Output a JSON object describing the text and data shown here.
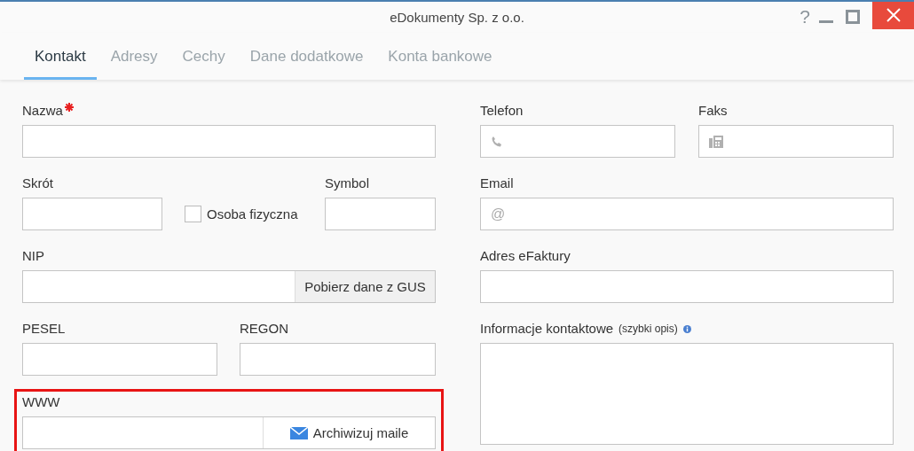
{
  "window": {
    "title": "eDokumenty Sp. z o.o.",
    "help": "?"
  },
  "tabs": [
    {
      "label": "Kontakt",
      "selected": true
    },
    {
      "label": "Adresy",
      "selected": false
    },
    {
      "label": "Cechy",
      "selected": false
    },
    {
      "label": "Dane dodatkowe",
      "selected": false
    },
    {
      "label": "Konta bankowe",
      "selected": false
    }
  ],
  "form": {
    "left": [
      [
        {
          "kind": "input",
          "label": "Nazwa",
          "required": true
        }
      ],
      [
        {
          "kind": "input",
          "label": "Skrót"
        },
        {
          "kind": "checkbox",
          "label": "Osoba fizyczna",
          "checked": false
        },
        {
          "kind": "input",
          "label": "Symbol"
        }
      ],
      [
        {
          "kind": "input_button",
          "label": "NIP",
          "button": {
            "kind": "plain",
            "label": "Pobierz dane z GUS"
          }
        }
      ],
      [
        {
          "kind": "input",
          "label": "PESEL"
        },
        {
          "kind": "input",
          "label": "REGON"
        }
      ],
      [
        {
          "kind": "input_button",
          "label": "WWW",
          "highlighted": true,
          "button": {
            "kind": "mail",
            "label": "Archiwizuj maile"
          }
        }
      ]
    ],
    "right": [
      [
        {
          "kind": "phone",
          "label": "Telefon"
        },
        {
          "kind": "fax",
          "label": "Faks"
        }
      ],
      [
        {
          "kind": "input",
          "label": "Email",
          "prefix": "@"
        }
      ],
      [
        {
          "kind": "input",
          "label": "Adres eFaktury"
        }
      ],
      [
        {
          "kind": "textarea",
          "label": "Informacje kontaktowe",
          "hint": "(szybki opis)",
          "info": true
        }
      ]
    ]
  }
}
